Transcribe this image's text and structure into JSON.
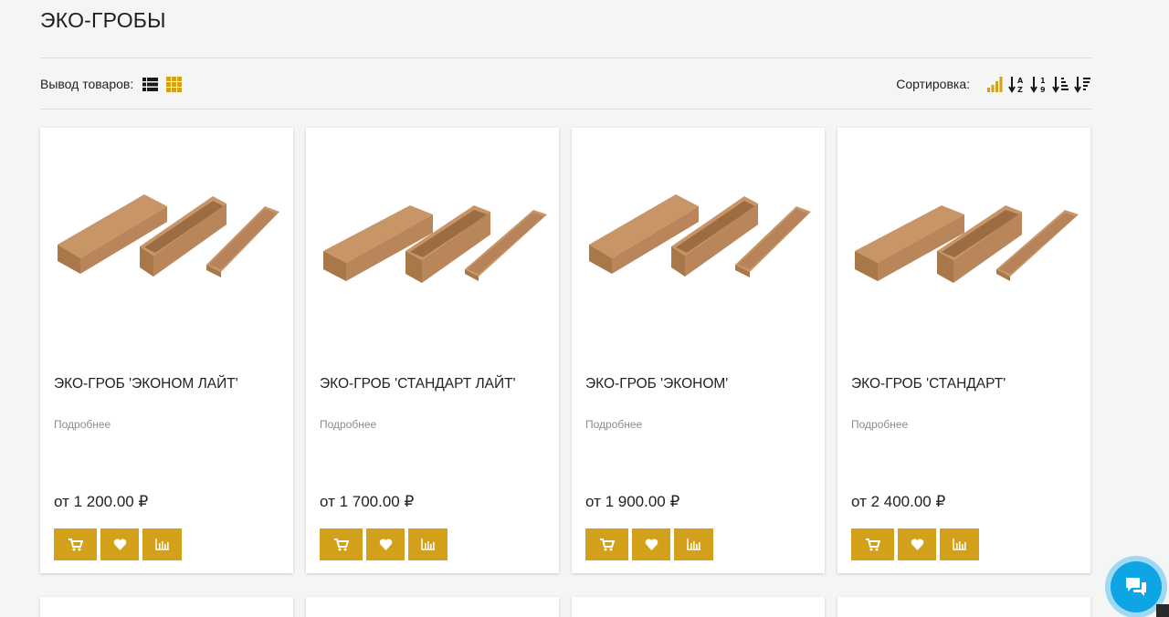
{
  "page": {
    "title": "ЭКО-ГРОБЫ"
  },
  "toolbar": {
    "view_label": "Вывод товаров:",
    "view_modes": [
      {
        "icon": "list-view-icon",
        "active": false
      },
      {
        "icon": "grid-view-icon",
        "active": true
      }
    ],
    "sort_label": "Сортировка:",
    "sort_options": [
      {
        "icon": "sort-popularity-icon",
        "active": true
      },
      {
        "icon": "sort-alpha-icon",
        "active": false
      },
      {
        "icon": "sort-numeric-icon",
        "active": false
      },
      {
        "icon": "sort-amount-asc-icon",
        "active": false
      },
      {
        "icon": "sort-amount-desc-icon",
        "active": false
      }
    ]
  },
  "products": [
    {
      "name": "ЭКО-ГРОБ 'ЭКОНОМ ЛАЙТ'",
      "details_label": "Подробнее",
      "price": "от 1 200.00 ₽"
    },
    {
      "name": "ЭКО-ГРОБ 'СТАНДАРТ ЛАЙТ'",
      "details_label": "Подробнее",
      "price": "от 1 700.00 ₽"
    },
    {
      "name": "ЭКО-ГРОБ 'ЭКОНОМ'",
      "details_label": "Подробнее",
      "price": "от 1 900.00 ₽"
    },
    {
      "name": "ЭКО-ГРОБ 'СТАНДАРТ'",
      "details_label": "Подробнее",
      "price": "от 2 400.00 ₽"
    }
  ],
  "card_actions": [
    "cart-icon",
    "heart-icon",
    "compare-chart-icon"
  ],
  "colors": {
    "accent": "#d3a01a",
    "background": "#f4f5f5",
    "card": "#ffffff",
    "chat_button": "#0ea5e5",
    "text": "#222222",
    "muted_text": "#8b8b8b"
  },
  "chat": {
    "icon": "chat-bubbles-icon"
  }
}
